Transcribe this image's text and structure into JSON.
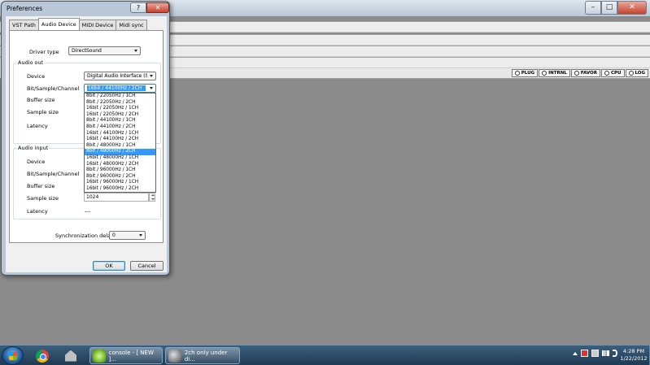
{
  "background_app": {
    "toolbar_buttons": [
      "PLUG",
      "INTRNL",
      "FAVOR",
      "CPU",
      "LOG"
    ],
    "window_controls": {
      "minimize": "–",
      "maximize": "□",
      "close": "✕"
    }
  },
  "dialog": {
    "title": "Preferences",
    "help": "?",
    "close": "✕",
    "tabs": [
      "VST Path",
      "Audio Device",
      "MIDI Device",
      "Midi sync"
    ],
    "active_tab": "Audio Device",
    "driver_type_label": "Driver type",
    "driver_type_value": "DirectSound",
    "audio_out": {
      "title": "Audio out",
      "device_label": "Device",
      "device_value": "Digital Audio Interface (SB",
      "bsc_label": "Bit/Sample/Channel",
      "bsc_value": "16bit / 44100Hz / 2CH",
      "buffer_label": "Buffer size",
      "sample_label": "Sample size",
      "latency_label": "Latency"
    },
    "bsc_options": [
      "8bit / 22050Hz / 1CH",
      "8bit / 22050Hz / 2CH",
      "16bit / 22050Hz / 1CH",
      "16bit / 22050Hz / 2CH",
      "8bit / 44100Hz / 1CH",
      "8bit / 44100Hz / 2CH",
      "16bit / 44100Hz / 1CH",
      "16bit / 44100Hz / 2CH",
      "8bit / 48000Hz / 1CH",
      "8bit / 48000Hz / 2CH",
      "16bit / 48000Hz / 1CH",
      "16bit / 48000Hz / 2CH",
      "8bit / 96000Hz / 1CH",
      "8bit / 96000Hz / 2CH",
      "16bit / 96000Hz / 1CH",
      "16bit / 96000Hz / 2CH"
    ],
    "highlighted_option_index": 9,
    "audio_input": {
      "title": "Audio input",
      "device_label": "Device",
      "bsc_label": "Bit/Sample/Channel",
      "buffer_label": "Buffer size",
      "sample_label": "Sample size",
      "sample_value": "1024",
      "latency_label": "Latency",
      "latency_value": "---"
    },
    "sync_delay_label": "Synchronization delay",
    "sync_delay_value": "0",
    "ok_label": "OK",
    "cancel_label": "Cancel"
  },
  "taskbar": {
    "tasks": [
      "console - [ NEW ]...",
      "2ch only under di..."
    ],
    "clock_time": "4:28 PM",
    "clock_date": "1/22/2012"
  }
}
